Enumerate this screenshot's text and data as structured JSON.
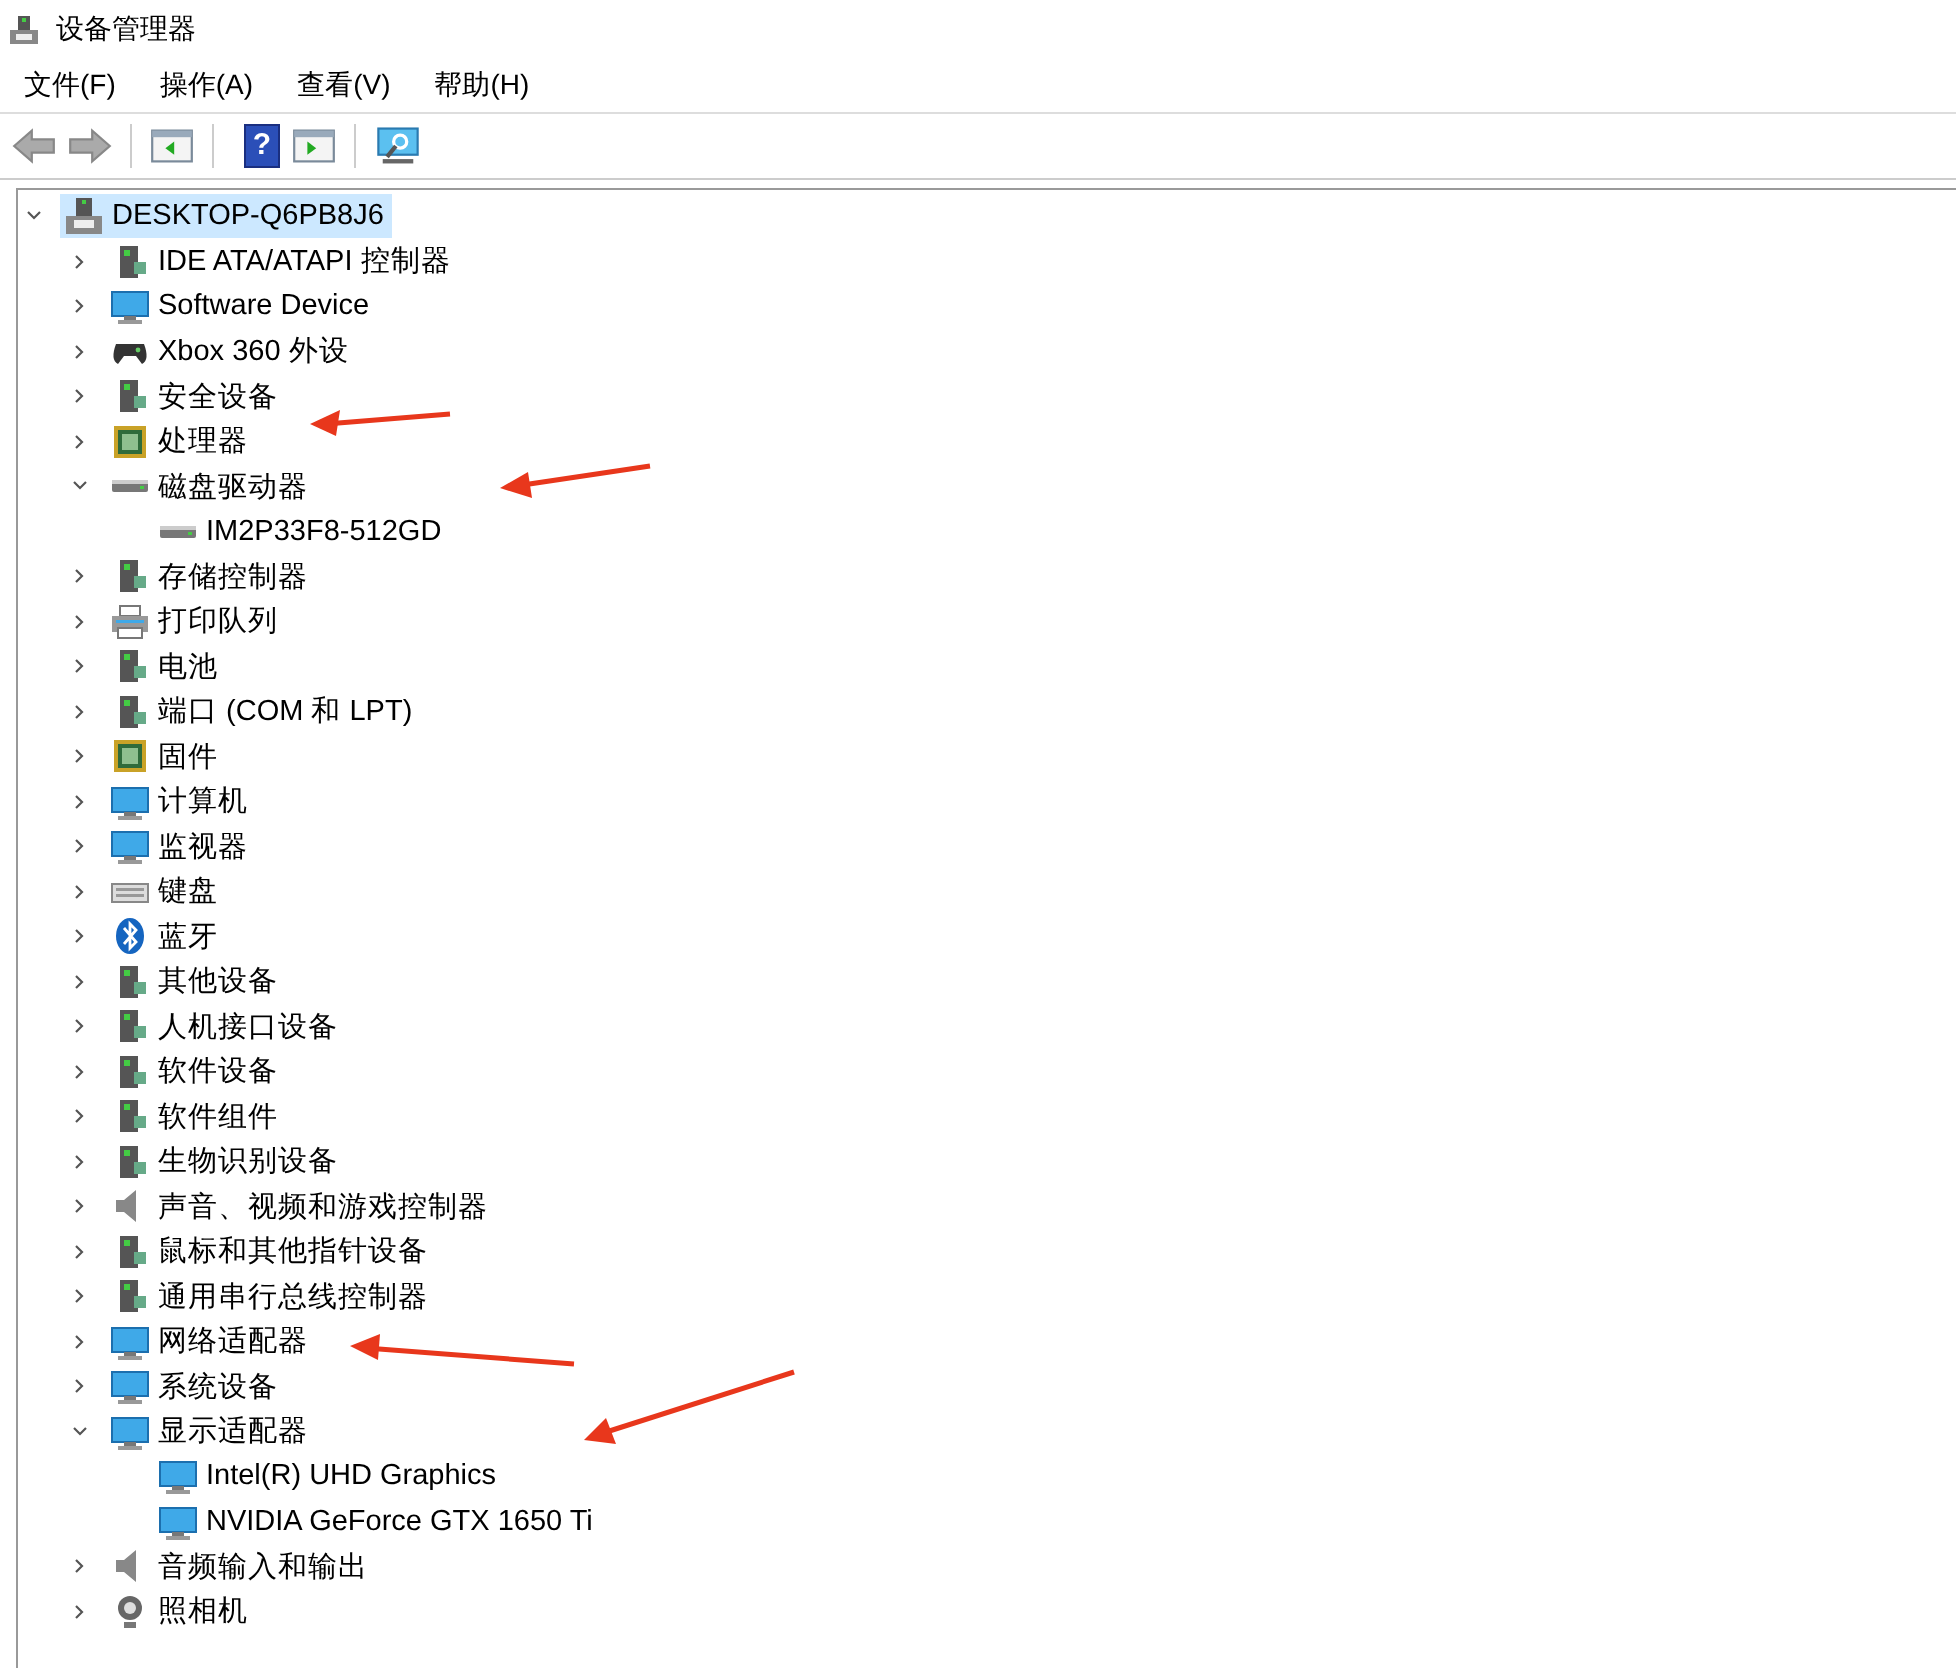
{
  "window": {
    "title": "设备管理器"
  },
  "menu": [
    "文件(F)",
    "操作(A)",
    "查看(V)",
    "帮助(H)"
  ],
  "toolbar": {
    "help_glyph": "?"
  },
  "tree": {
    "label": "DESKTOP-Q6PB8J6",
    "expanded": true,
    "selected": true,
    "children": [
      {
        "label": "IDE ATA/ATAPI 控制器",
        "expanded": false
      },
      {
        "label": "Software Device",
        "expanded": false
      },
      {
        "label": "Xbox 360 外设",
        "expanded": false
      },
      {
        "label": "安全设备",
        "expanded": false
      },
      {
        "label": "处理器",
        "expanded": false
      },
      {
        "label": "磁盘驱动器",
        "expanded": true,
        "children": [
          {
            "label": "IM2P33F8-512GD"
          }
        ]
      },
      {
        "label": "存储控制器",
        "expanded": false
      },
      {
        "label": "打印队列",
        "expanded": false
      },
      {
        "label": "电池",
        "expanded": false
      },
      {
        "label": "端口 (COM 和 LPT)",
        "expanded": false
      },
      {
        "label": "固件",
        "expanded": false
      },
      {
        "label": "计算机",
        "expanded": false
      },
      {
        "label": "监视器",
        "expanded": false
      },
      {
        "label": "键盘",
        "expanded": false
      },
      {
        "label": "蓝牙",
        "expanded": false
      },
      {
        "label": "其他设备",
        "expanded": false
      },
      {
        "label": "人机接口设备",
        "expanded": false
      },
      {
        "label": "软件设备",
        "expanded": false
      },
      {
        "label": "软件组件",
        "expanded": false
      },
      {
        "label": "生物识别设备",
        "expanded": false
      },
      {
        "label": "声音、视频和游戏控制器",
        "expanded": false
      },
      {
        "label": "鼠标和其他指针设备",
        "expanded": false
      },
      {
        "label": "通用串行总线控制器",
        "expanded": false
      },
      {
        "label": "网络适配器",
        "expanded": false
      },
      {
        "label": "系统设备",
        "expanded": false
      },
      {
        "label": "显示适配器",
        "expanded": true,
        "children": [
          {
            "label": "Intel(R) UHD Graphics"
          },
          {
            "label": "NVIDIA GeForce GTX 1650 Ti"
          }
        ]
      },
      {
        "label": "音频输入和输出",
        "expanded": false
      },
      {
        "label": "照相机",
        "expanded": false
      }
    ]
  }
}
